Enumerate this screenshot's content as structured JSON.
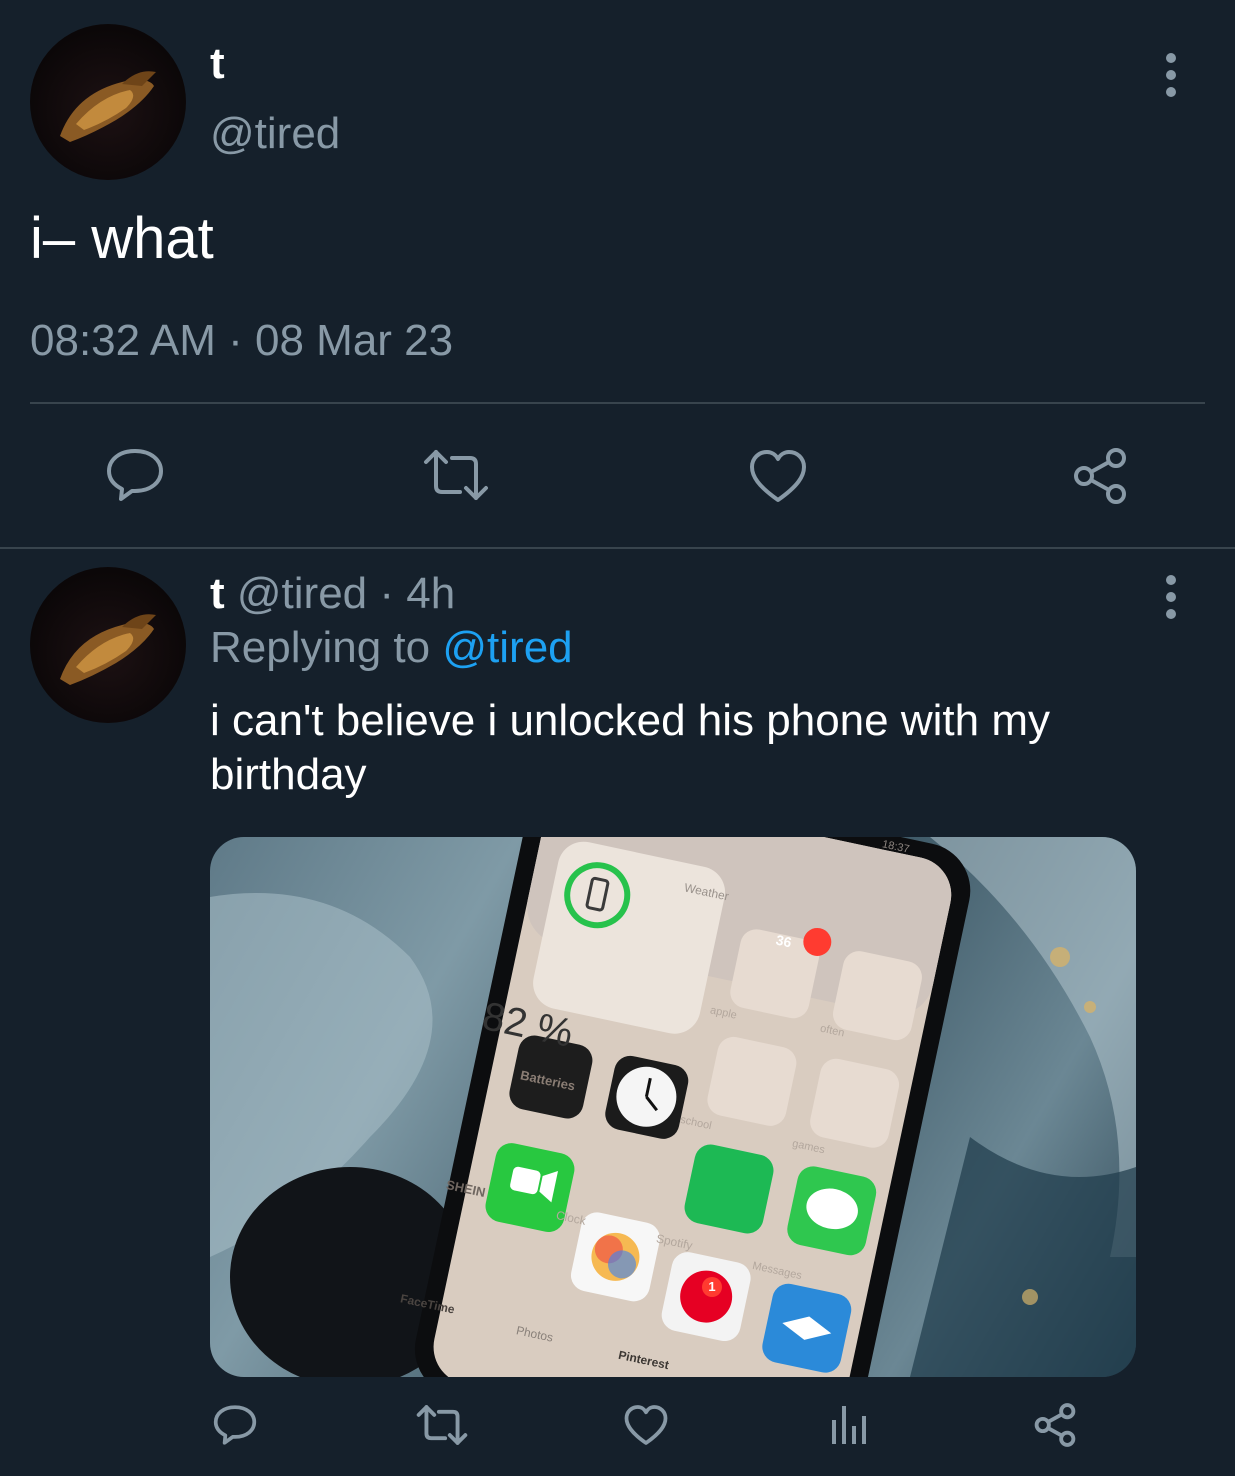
{
  "main_tweet": {
    "display_name": "t",
    "handle": "@tired",
    "text": "i– what",
    "timestamp": "08:32 AM · 08 Mar 23"
  },
  "reply": {
    "display_name": "t",
    "handle": "@tired",
    "time_ago": "· 4h",
    "replying_to_label": "Replying to",
    "replying_to_handle": "@tired",
    "text": "i can't believe i unlocked his phone with my birthday",
    "media": {
      "battery_percent": "82 %",
      "battery_widget_label": "Batteries",
      "weather_label": "Weather",
      "status_time": "18:37",
      "folder_badge": "36",
      "folder_apple_label": "apple",
      "folder_school_label": "school",
      "folder_games_label": "games",
      "folder_often_label": "often",
      "app_shein_label": "SHEIN",
      "app_clock_label": "Clock",
      "app_spotify_label": "Spotify",
      "app_messages_label": "Messages",
      "app_facetime_label": "FaceTime",
      "app_photos_label": "Photos",
      "app_pinterest_label": "Pinterest",
      "pinterest_badge": "1"
    }
  },
  "colors": {
    "background": "#15202b",
    "muted_text": "#8899a6",
    "accent": "#1da1f2",
    "divider": "#38444d"
  },
  "icons": [
    "comment-icon",
    "retweet-icon",
    "like-icon",
    "share-icon",
    "analytics-icon",
    "more-icon"
  ]
}
